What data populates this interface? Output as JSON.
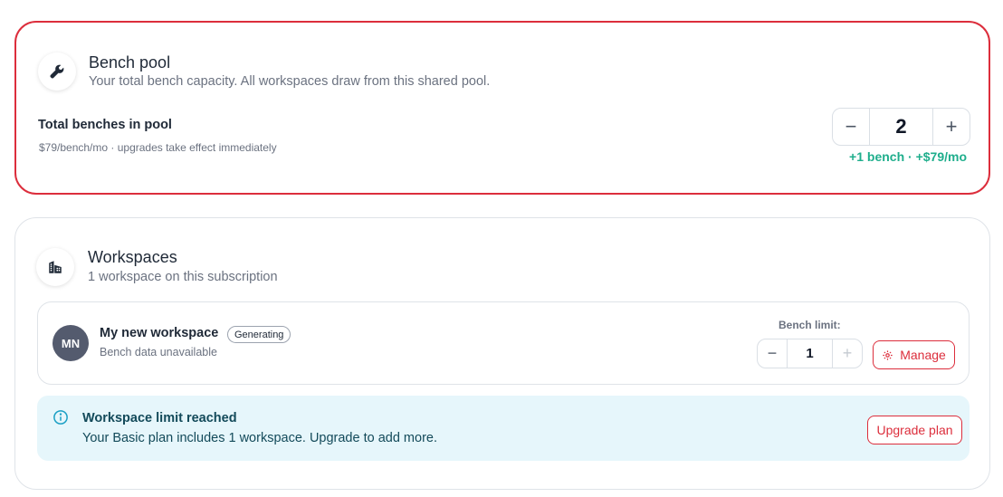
{
  "bench_pool": {
    "icon": "wrench-icon",
    "title": "Bench pool",
    "subtitle": "Your total bench capacity. All workspaces draw from this shared pool.",
    "total_label": "Total benches in pool",
    "price_note": "$79/bench/mo · upgrades take effect immediately",
    "stepper": {
      "decrement": "−",
      "value": "2",
      "increment": "+"
    },
    "delta": "+1 bench · +$79/mo"
  },
  "workspaces": {
    "icon": "building-icon",
    "title": "Workspaces",
    "subtitle": "1 workspace on this subscription",
    "items": [
      {
        "initials": "MN",
        "name": "My new workspace",
        "status": "Generating",
        "meta": "Bench data unavailable",
        "limit_label": "Bench limit:",
        "stepper": {
          "decrement": "−",
          "value": "1",
          "increment": "+"
        },
        "manage_label": "Manage"
      }
    ]
  },
  "alert": {
    "icon": "info-icon",
    "title": "Workspace limit reached",
    "text": "Your Basic plan includes 1 workspace. Upgrade to add more.",
    "button": "Upgrade plan"
  },
  "colors": {
    "danger": "#dc2e3c",
    "success": "#1fae8c",
    "info_bg": "#e6f6fb",
    "avatar_bg": "#545b6e"
  }
}
